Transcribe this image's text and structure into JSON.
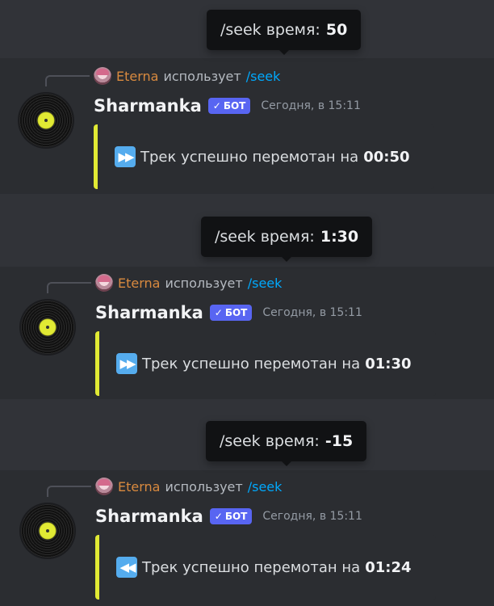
{
  "app": {
    "accent": "#e1ea34",
    "brand": "#5865f2",
    "link": "#00a8fc",
    "user_color": "#d98a3f"
  },
  "entries": [
    {
      "tooltip_cmd": "/seek время:",
      "tooltip_value": "50",
      "reply_user": "Eterna",
      "reply_text": "использует",
      "reply_command": "/seek",
      "bot_name": "Sharmanka",
      "badge": "БОТ",
      "timestamp": "Сегодня, в 15:11",
      "emoji": "fast-forward-icon",
      "message": "Трек успешно перемотан на",
      "time_value": "00:50"
    },
    {
      "tooltip_cmd": "/seek время:",
      "tooltip_value": "1:30",
      "reply_user": "Eterna",
      "reply_text": "использует",
      "reply_command": "/seek",
      "bot_name": "Sharmanka",
      "badge": "БОТ",
      "timestamp": "Сегодня, в 15:11",
      "emoji": "fast-forward-icon",
      "message": "Трек успешно перемотан на",
      "time_value": "01:30"
    },
    {
      "tooltip_cmd": "/seek время:",
      "tooltip_value": "-15",
      "reply_user": "Eterna",
      "reply_text": "использует",
      "reply_command": "/seek",
      "bot_name": "Sharmanka",
      "badge": "БОТ",
      "timestamp": "Сегодня, в 15:11",
      "emoji": "rewind-icon",
      "message": "Трек успешно перемотан на",
      "time_value": "01:24"
    }
  ]
}
